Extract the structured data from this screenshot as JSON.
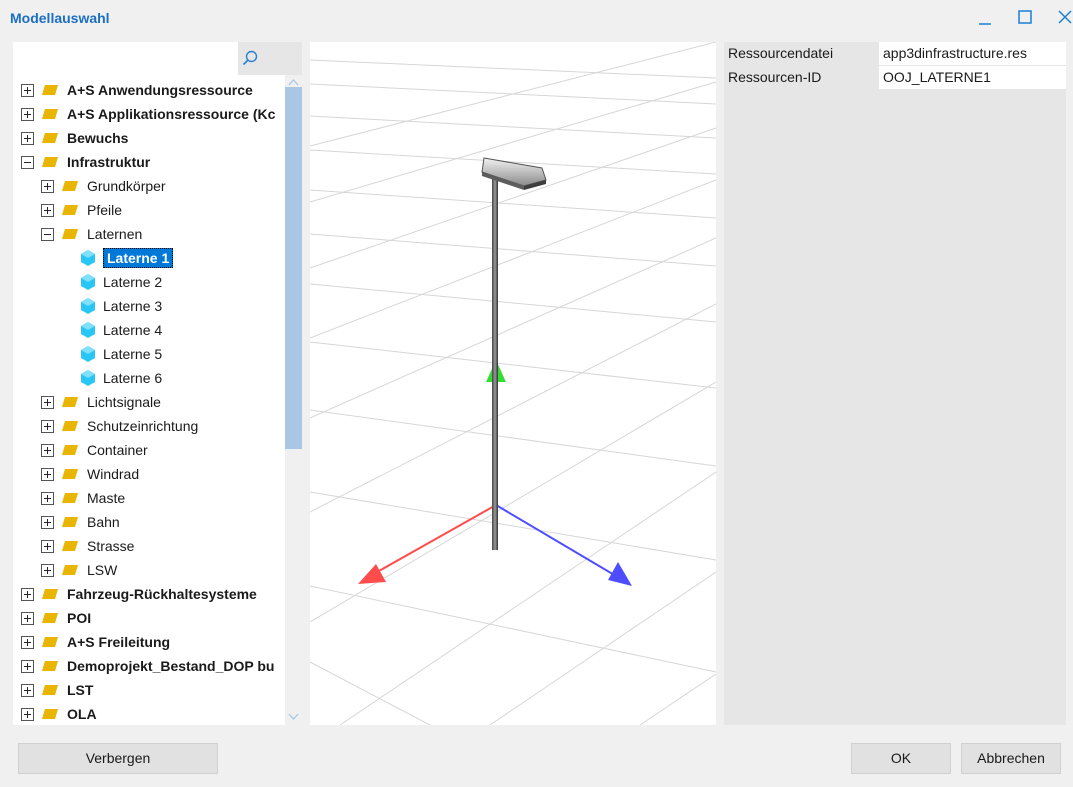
{
  "window": {
    "title": "Modellauswahl"
  },
  "search": {
    "placeholder": ""
  },
  "tree": {
    "items": [
      {
        "label": "A+S Anwendungsressource",
        "level": 0,
        "expanded": false,
        "bold": true,
        "type": "folder"
      },
      {
        "label": "A+S Applikationsressource (Kc",
        "level": 0,
        "expanded": false,
        "bold": true,
        "type": "folder"
      },
      {
        "label": "Bewuchs",
        "level": 0,
        "expanded": false,
        "bold": true,
        "type": "folder"
      },
      {
        "label": "Infrastruktur",
        "level": 0,
        "expanded": true,
        "bold": true,
        "type": "folder"
      },
      {
        "label": "Grundkörper",
        "level": 1,
        "expanded": false,
        "bold": false,
        "type": "folder"
      },
      {
        "label": "Pfeile",
        "level": 1,
        "expanded": false,
        "bold": false,
        "type": "folder"
      },
      {
        "label": "Laternen",
        "level": 1,
        "expanded": true,
        "bold": false,
        "type": "folder"
      },
      {
        "label": "Laterne 1",
        "level": 2,
        "bold": false,
        "type": "model",
        "selected": true
      },
      {
        "label": "Laterne 2",
        "level": 2,
        "bold": false,
        "type": "model"
      },
      {
        "label": "Laterne 3",
        "level": 2,
        "bold": false,
        "type": "model"
      },
      {
        "label": "Laterne 4",
        "level": 2,
        "bold": false,
        "type": "model"
      },
      {
        "label": "Laterne 5",
        "level": 2,
        "bold": false,
        "type": "model"
      },
      {
        "label": "Laterne 6",
        "level": 2,
        "bold": false,
        "type": "model"
      },
      {
        "label": "Lichtsignale",
        "level": 1,
        "expanded": false,
        "bold": false,
        "type": "folder"
      },
      {
        "label": "Schutzeinrichtung",
        "level": 1,
        "expanded": false,
        "bold": false,
        "type": "folder"
      },
      {
        "label": "Container",
        "level": 1,
        "expanded": false,
        "bold": false,
        "type": "folder"
      },
      {
        "label": "Windrad",
        "level": 1,
        "expanded": false,
        "bold": false,
        "type": "folder"
      },
      {
        "label": "Maste",
        "level": 1,
        "expanded": false,
        "bold": false,
        "type": "folder"
      },
      {
        "label": "Bahn",
        "level": 1,
        "expanded": false,
        "bold": false,
        "type": "folder"
      },
      {
        "label": "Strasse",
        "level": 1,
        "expanded": false,
        "bold": false,
        "type": "folder"
      },
      {
        "label": "LSW",
        "level": 1,
        "expanded": false,
        "bold": false,
        "type": "folder"
      },
      {
        "label": "Fahrzeug-Rückhaltesysteme",
        "level": 0,
        "expanded": false,
        "bold": true,
        "type": "folder"
      },
      {
        "label": "POI",
        "level": 0,
        "expanded": false,
        "bold": true,
        "type": "folder"
      },
      {
        "label": "A+S Freileitung",
        "level": 0,
        "expanded": false,
        "bold": true,
        "type": "folder"
      },
      {
        "label": "Demoprojekt_Bestand_DOP bu",
        "level": 0,
        "expanded": false,
        "bold": true,
        "type": "folder"
      },
      {
        "label": "LST",
        "level": 0,
        "expanded": false,
        "bold": true,
        "type": "folder"
      },
      {
        "label": "OLA",
        "level": 0,
        "expanded": false,
        "bold": true,
        "type": "folder"
      }
    ]
  },
  "properties": [
    {
      "key": "Ressourcendatei",
      "value": "app3dinfrastructure.res"
    },
    {
      "key": "Ressourcen-ID",
      "value": "OOJ_LATERNE1"
    }
  ],
  "buttons": {
    "hide": "Verbergen",
    "ok": "OK",
    "cancel": "Abbrechen"
  },
  "colors": {
    "accent": "#0078d7",
    "title": "#1a6fc4",
    "folder": "#e8b600",
    "model_icon": "#29c5f6",
    "axis_x": "#ff4d4d",
    "axis_y": "#33dd33",
    "axis_z": "#4d4dff"
  },
  "icons": {
    "search": "search-icon",
    "minimize": "minimize-icon",
    "maximize": "maximize-icon",
    "close": "close-icon"
  }
}
